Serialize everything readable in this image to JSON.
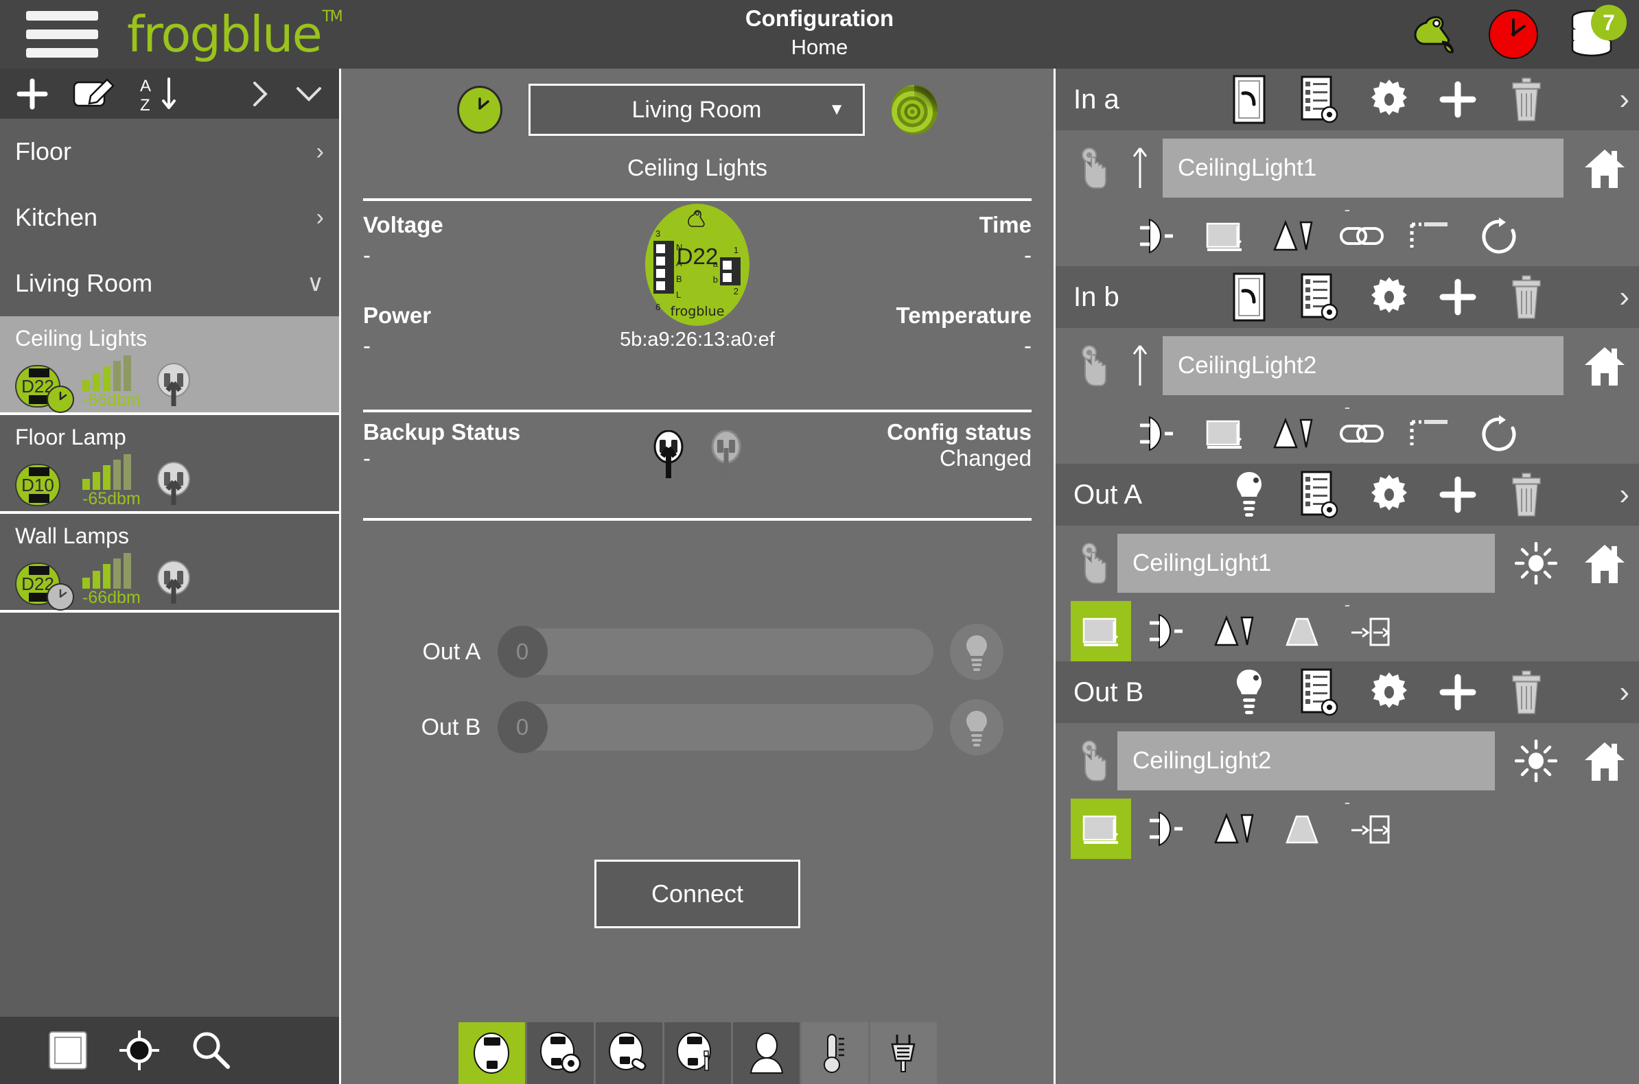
{
  "header": {
    "menu_label": "menu",
    "logo": "frogblue",
    "logo_tm": "TM",
    "title": "Configuration",
    "subtitle": "Home",
    "frog_icon": "frog-icon",
    "clock_icon": "clock-icon",
    "database_icon": "database-icon",
    "database_badge": "7",
    "accent_green": "#9ac31c",
    "alert_red": "#ee0000"
  },
  "sidebar": {
    "toolbar": {
      "add_label": "+",
      "edit_icon": "edit-icon",
      "sort_icon": "sort-az-icon",
      "expand_icon": "chevron-right-icon",
      "collapse_icon": "chevron-down-icon"
    },
    "categories": [
      {
        "label": "Floor",
        "chevron": "›",
        "expanded": false
      },
      {
        "label": "Kitchen",
        "chevron": "›",
        "expanded": false
      },
      {
        "label": "Living Room",
        "chevron": "∨",
        "expanded": true
      }
    ],
    "devices": [
      {
        "name": "Ceiling Lights",
        "chip": "D22",
        "signal": "-66dbm",
        "bars": 3,
        "has_clock": true,
        "clock_color": "green",
        "active": true
      },
      {
        "name": "Floor Lamp",
        "chip": "D10",
        "signal": "-65dbm",
        "bars": 3,
        "has_clock": false,
        "clock_color": "",
        "active": false
      },
      {
        "name": "Wall Lamps",
        "chip": "D22",
        "signal": "-66dbm",
        "bars": 3,
        "has_clock": true,
        "clock_color": "grey",
        "active": false
      }
    ],
    "bottom_tools": [
      {
        "icon": "square-icon"
      },
      {
        "icon": "target-icon"
      },
      {
        "icon": "search-icon"
      }
    ]
  },
  "center": {
    "clock_button_icon": "clock-icon",
    "room_select_value": "Living Room",
    "room_select_caret": "▼",
    "radar_icon": "radar-icon",
    "device_title": "Ceiling Lights",
    "stats": {
      "voltage_label": "Voltage",
      "voltage_value": "-",
      "time_label": "Time",
      "time_value": "-",
      "power_label": "Power",
      "power_value": "-",
      "temperature_label": "Temperature",
      "temperature_value": "-"
    },
    "device": {
      "name": "D22",
      "brand": "frogblue",
      "mac": "5b:a9:26:13:a0:ef",
      "terminals_left": [
        "N",
        "A",
        "B",
        "L"
      ],
      "terminals_right": [
        "a",
        "b"
      ],
      "num_tl": "3",
      "num_bl": "6",
      "num_tr": "1",
      "num_br": "2"
    },
    "backup": {
      "label": "Backup Status",
      "value": "-",
      "upload_icon": "upload-plug-icon",
      "download_icon": "download-plug-icon"
    },
    "config": {
      "label": "Config status",
      "value": "Changed"
    },
    "outputs": [
      {
        "label": "Out A",
        "value": "0",
        "bulb_icon": "bulb-icon"
      },
      {
        "label": "Out B",
        "value": "0",
        "bulb_icon": "bulb-icon"
      }
    ],
    "connect_label": "Connect",
    "tabs": [
      {
        "icon": "device-icon",
        "active": true,
        "light": false
      },
      {
        "icon": "device-gear-icon",
        "active": false,
        "light": false
      },
      {
        "icon": "device-link-icon",
        "active": false,
        "light": false
      },
      {
        "icon": "device-slider-icon",
        "active": false,
        "light": false
      },
      {
        "icon": "person-icon",
        "active": false,
        "light": false
      },
      {
        "icon": "thermometer-icon",
        "active": false,
        "light": true
      },
      {
        "icon": "plug-icon",
        "active": false,
        "light": true
      }
    ]
  },
  "right": {
    "sections": [
      {
        "title": "In a",
        "type_icon": "switch-icon",
        "tools": [
          "list-gear-icon",
          "gear-icon",
          "plus-icon",
          "trash-icon"
        ],
        "chevron": "›",
        "row": {
          "hand_icon": "touch-hand-icon",
          "arrow_icon": "arrow-up-icon",
          "name": "CeilingLight1",
          "end_icon": "house-icon"
        },
        "icons": [
          "plug-half-icon",
          "blind-icon",
          "triangles-icon",
          "link-icon",
          "dashed-step-icon",
          "refresh-icon"
        ],
        "dash": "-",
        "highlight_index": -1
      },
      {
        "title": "In b",
        "type_icon": "switch-icon",
        "tools": [
          "list-gear-icon",
          "gear-icon",
          "plus-icon",
          "trash-icon"
        ],
        "chevron": "›",
        "row": {
          "hand_icon": "touch-hand-icon",
          "arrow_icon": "arrow-up-icon",
          "name": "CeilingLight2",
          "end_icon": "house-icon"
        },
        "icons": [
          "plug-half-icon",
          "blind-icon",
          "triangles-icon",
          "link-icon",
          "dashed-step-icon",
          "refresh-icon"
        ],
        "dash": "-",
        "highlight_index": -1
      },
      {
        "title": "Out A",
        "type_icon": "bulb-icon",
        "tools": [
          "list-gear-icon",
          "gear-icon",
          "plus-icon",
          "trash-icon"
        ],
        "chevron": "›",
        "row": {
          "hand_icon": "touch-hand-icon",
          "arrow_icon": "",
          "name": "CeilingLight1",
          "brightness_icon": "sun-icon",
          "end_icon": "house-icon"
        },
        "icons": [
          "blind-icon",
          "plug-half-icon",
          "triangles-icon",
          "trapezoid-icon",
          "arrow-door-icon"
        ],
        "dash": "-",
        "highlight_index": 0
      },
      {
        "title": "Out B",
        "type_icon": "bulb-icon",
        "tools": [
          "list-gear-icon",
          "gear-icon",
          "plus-icon",
          "trash-icon"
        ],
        "chevron": "›",
        "row": {
          "hand_icon": "touch-hand-icon",
          "arrow_icon": "",
          "name": "CeilingLight2",
          "brightness_icon": "sun-icon",
          "end_icon": "house-icon"
        },
        "icons": [
          "blind-icon",
          "plug-half-icon",
          "triangles-icon",
          "trapezoid-icon",
          "arrow-door-icon"
        ],
        "dash": "-",
        "highlight_index": 0
      }
    ]
  }
}
